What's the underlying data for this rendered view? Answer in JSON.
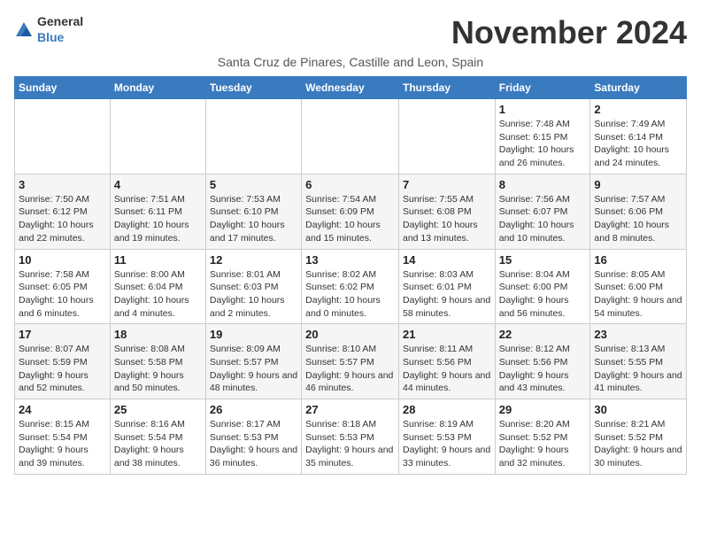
{
  "header": {
    "logo_general": "General",
    "logo_blue": "Blue",
    "month_year": "November 2024",
    "location": "Santa Cruz de Pinares, Castille and Leon, Spain"
  },
  "weekdays": [
    "Sunday",
    "Monday",
    "Tuesday",
    "Wednesday",
    "Thursday",
    "Friday",
    "Saturday"
  ],
  "weeks": [
    [
      {
        "day": "",
        "info": ""
      },
      {
        "day": "",
        "info": ""
      },
      {
        "day": "",
        "info": ""
      },
      {
        "day": "",
        "info": ""
      },
      {
        "day": "",
        "info": ""
      },
      {
        "day": "1",
        "info": "Sunrise: 7:48 AM\nSunset: 6:15 PM\nDaylight: 10 hours and 26 minutes."
      },
      {
        "day": "2",
        "info": "Sunrise: 7:49 AM\nSunset: 6:14 PM\nDaylight: 10 hours and 24 minutes."
      }
    ],
    [
      {
        "day": "3",
        "info": "Sunrise: 7:50 AM\nSunset: 6:12 PM\nDaylight: 10 hours and 22 minutes."
      },
      {
        "day": "4",
        "info": "Sunrise: 7:51 AM\nSunset: 6:11 PM\nDaylight: 10 hours and 19 minutes."
      },
      {
        "day": "5",
        "info": "Sunrise: 7:53 AM\nSunset: 6:10 PM\nDaylight: 10 hours and 17 minutes."
      },
      {
        "day": "6",
        "info": "Sunrise: 7:54 AM\nSunset: 6:09 PM\nDaylight: 10 hours and 15 minutes."
      },
      {
        "day": "7",
        "info": "Sunrise: 7:55 AM\nSunset: 6:08 PM\nDaylight: 10 hours and 13 minutes."
      },
      {
        "day": "8",
        "info": "Sunrise: 7:56 AM\nSunset: 6:07 PM\nDaylight: 10 hours and 10 minutes."
      },
      {
        "day": "9",
        "info": "Sunrise: 7:57 AM\nSunset: 6:06 PM\nDaylight: 10 hours and 8 minutes."
      }
    ],
    [
      {
        "day": "10",
        "info": "Sunrise: 7:58 AM\nSunset: 6:05 PM\nDaylight: 10 hours and 6 minutes."
      },
      {
        "day": "11",
        "info": "Sunrise: 8:00 AM\nSunset: 6:04 PM\nDaylight: 10 hours and 4 minutes."
      },
      {
        "day": "12",
        "info": "Sunrise: 8:01 AM\nSunset: 6:03 PM\nDaylight: 10 hours and 2 minutes."
      },
      {
        "day": "13",
        "info": "Sunrise: 8:02 AM\nSunset: 6:02 PM\nDaylight: 10 hours and 0 minutes."
      },
      {
        "day": "14",
        "info": "Sunrise: 8:03 AM\nSunset: 6:01 PM\nDaylight: 9 hours and 58 minutes."
      },
      {
        "day": "15",
        "info": "Sunrise: 8:04 AM\nSunset: 6:00 PM\nDaylight: 9 hours and 56 minutes."
      },
      {
        "day": "16",
        "info": "Sunrise: 8:05 AM\nSunset: 6:00 PM\nDaylight: 9 hours and 54 minutes."
      }
    ],
    [
      {
        "day": "17",
        "info": "Sunrise: 8:07 AM\nSunset: 5:59 PM\nDaylight: 9 hours and 52 minutes."
      },
      {
        "day": "18",
        "info": "Sunrise: 8:08 AM\nSunset: 5:58 PM\nDaylight: 9 hours and 50 minutes."
      },
      {
        "day": "19",
        "info": "Sunrise: 8:09 AM\nSunset: 5:57 PM\nDaylight: 9 hours and 48 minutes."
      },
      {
        "day": "20",
        "info": "Sunrise: 8:10 AM\nSunset: 5:57 PM\nDaylight: 9 hours and 46 minutes."
      },
      {
        "day": "21",
        "info": "Sunrise: 8:11 AM\nSunset: 5:56 PM\nDaylight: 9 hours and 44 minutes."
      },
      {
        "day": "22",
        "info": "Sunrise: 8:12 AM\nSunset: 5:56 PM\nDaylight: 9 hours and 43 minutes."
      },
      {
        "day": "23",
        "info": "Sunrise: 8:13 AM\nSunset: 5:55 PM\nDaylight: 9 hours and 41 minutes."
      }
    ],
    [
      {
        "day": "24",
        "info": "Sunrise: 8:15 AM\nSunset: 5:54 PM\nDaylight: 9 hours and 39 minutes."
      },
      {
        "day": "25",
        "info": "Sunrise: 8:16 AM\nSunset: 5:54 PM\nDaylight: 9 hours and 38 minutes."
      },
      {
        "day": "26",
        "info": "Sunrise: 8:17 AM\nSunset: 5:53 PM\nDaylight: 9 hours and 36 minutes."
      },
      {
        "day": "27",
        "info": "Sunrise: 8:18 AM\nSunset: 5:53 PM\nDaylight: 9 hours and 35 minutes."
      },
      {
        "day": "28",
        "info": "Sunrise: 8:19 AM\nSunset: 5:53 PM\nDaylight: 9 hours and 33 minutes."
      },
      {
        "day": "29",
        "info": "Sunrise: 8:20 AM\nSunset: 5:52 PM\nDaylight: 9 hours and 32 minutes."
      },
      {
        "day": "30",
        "info": "Sunrise: 8:21 AM\nSunset: 5:52 PM\nDaylight: 9 hours and 30 minutes."
      }
    ]
  ]
}
